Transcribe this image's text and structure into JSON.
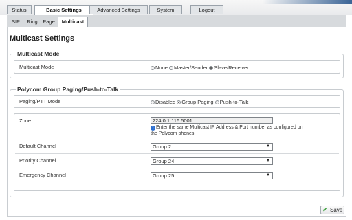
{
  "main_tabs": [
    "Status",
    "Basic Settings",
    "Advanced Settings",
    "System",
    "Logout"
  ],
  "sub_tabs": [
    "SIP",
    "Ring",
    "Page",
    "Multicast"
  ],
  "page_title": "Multicast Settings",
  "multicast_mode": {
    "legend": "Multicast Mode",
    "label": "Multicast Mode",
    "options": [
      "None",
      "Master/Sender",
      "Slave/Receiver"
    ],
    "selected": "Slave/Receiver"
  },
  "paging": {
    "legend": "Polycom Group Paging/Push-to-Talk",
    "mode_label": "Paging/PTT Mode",
    "options": [
      "Disabled",
      "Group Paging",
      "Push-to-Talk"
    ],
    "selected": "Group Paging",
    "zone_label": "Zone",
    "zone_value": "224.0.1.116:5001",
    "zone_hint_1": "Enter the same Multicast IP Address & Port number as configured on",
    "zone_hint_2": "the Polycom phones.",
    "default_channel_label": "Default Channel",
    "default_channel_value": "Group 2",
    "priority_channel_label": "Priority Channel",
    "priority_channel_value": "Group 24",
    "emergency_channel_label": "Emergency Channel",
    "emergency_channel_value": "Group 25"
  },
  "save_label": "Save",
  "icons": {
    "info": "info-icon",
    "save": "check-icon",
    "dropdown": "chevron-down-icon"
  },
  "colors": {
    "accent_blue": "#3a6496",
    "info_blue": "#2d6fd0",
    "save_green": "#2e9a2e"
  }
}
